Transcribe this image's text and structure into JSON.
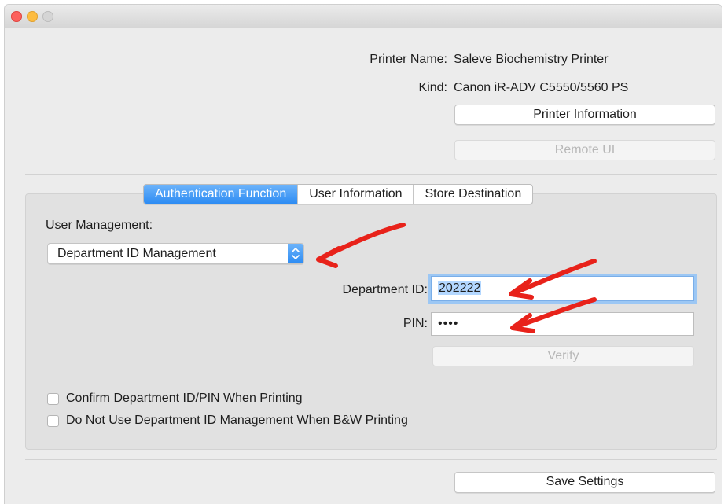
{
  "window": {
    "controls": [
      "close",
      "minimize",
      "zoom"
    ]
  },
  "printer": {
    "name_label": "Printer Name:",
    "name_value": "Saleve Biochemistry Printer",
    "kind_label": "Kind:",
    "kind_value": "Canon iR-ADV C5550/5560 PS",
    "info_button": "Printer Information",
    "remote_button": "Remote UI"
  },
  "tabs": [
    {
      "label": "Authentication Function",
      "active": true
    },
    {
      "label": "User Information",
      "active": false
    },
    {
      "label": "Store Destination",
      "active": false
    }
  ],
  "auth": {
    "user_management_label": "User Management:",
    "user_management_value": "Department ID Management",
    "department_id_label": "Department ID:",
    "department_id_value": "202222",
    "pin_label": "PIN:",
    "pin_value": "••••",
    "verify_button": "Verify",
    "options": [
      {
        "label": "Confirm Department ID/PIN When Printing",
        "checked": false
      },
      {
        "label": "Do Not Use Department ID Management When B&W Printing",
        "checked": false
      }
    ]
  },
  "footer": {
    "save_button": "Save Settings"
  },
  "annotations": {
    "arrow_color": "#e8221a",
    "accent_color": "#2d8cf3"
  }
}
